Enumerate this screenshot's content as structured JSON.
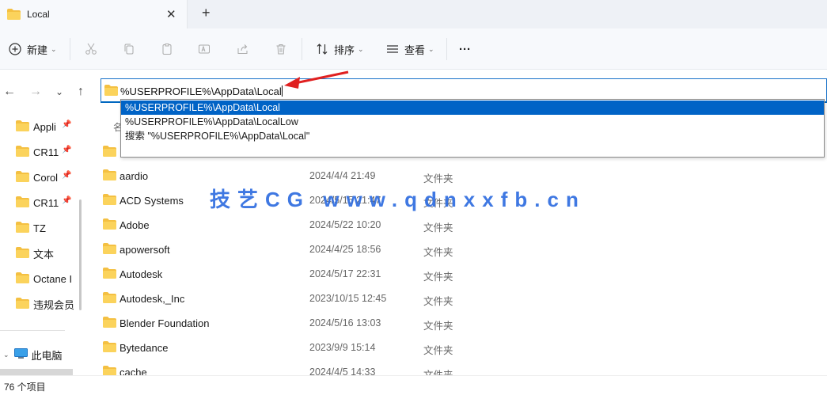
{
  "tab": {
    "title": "Local",
    "close": "✕",
    "new_tab": "+"
  },
  "toolbar": {
    "new_label": "新建",
    "sort_label": "排序",
    "view_label": "查看",
    "more_label": "···"
  },
  "address": {
    "value": "%USERPROFILE%\\AppData\\Local"
  },
  "suggestions": [
    "%USERPROFILE%\\AppData\\Local",
    "%USERPROFILE%\\AppData\\LocalLow",
    "搜索 \"%USERPROFILE%\\AppData\\Local\""
  ],
  "sidebar": {
    "items": [
      {
        "label": "Appli",
        "pinned": true
      },
      {
        "label": "CR11",
        "pinned": true
      },
      {
        "label": "Corol",
        "pinned": true
      },
      {
        "label": "CR11",
        "pinned": true
      },
      {
        "label": "TZ",
        "pinned": false
      },
      {
        "label": "文本",
        "pinned": false
      },
      {
        "label": "Octane I",
        "pinned": false
      },
      {
        "label": "违规会员",
        "pinned": false
      }
    ],
    "this_pc": "此电脑"
  },
  "list": {
    "name_header": "名",
    "rows": [
      {
        "name": "aardio",
        "date": "2024/4/4 21:49",
        "type": "文件夹"
      },
      {
        "name": "ACD Systems",
        "date": "2024/5/15 21:47",
        "type": "文件夹"
      },
      {
        "name": "Adobe",
        "date": "2024/5/22 10:20",
        "type": "文件夹"
      },
      {
        "name": "apowersoft",
        "date": "2024/4/25 18:56",
        "type": "文件夹"
      },
      {
        "name": "Autodesk",
        "date": "2024/5/17 22:31",
        "type": "文件夹"
      },
      {
        "name": "Autodesk,_Inc",
        "date": "2023/10/15 12:45",
        "type": "文件夹"
      },
      {
        "name": "Blender Foundation",
        "date": "2024/5/16 13:03",
        "type": "文件夹"
      },
      {
        "name": "Bytedance",
        "date": "2023/9/9 15:14",
        "type": "文件夹"
      },
      {
        "name": "cache",
        "date": "2024/4/5 14:33",
        "type": "文件夹"
      }
    ]
  },
  "status": {
    "count": "76 个项目"
  },
  "watermark": "技艺CG www.qdnxxfb.cn",
  "colors": {
    "accent": "#0063c6",
    "folder": "#f4c042",
    "watermark": "#2f6de0",
    "arrow": "#e02020"
  }
}
